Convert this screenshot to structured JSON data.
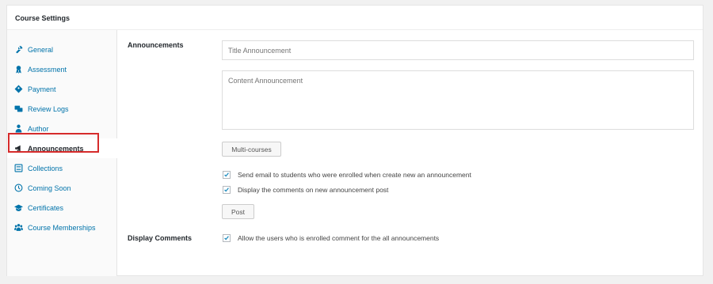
{
  "panel": {
    "title": "Course Settings"
  },
  "sidebar": {
    "items": [
      {
        "label": "General",
        "icon": "wrench-icon",
        "active": false
      },
      {
        "label": "Assessment",
        "icon": "award-icon",
        "active": false
      },
      {
        "label": "Payment",
        "icon": "tag-icon",
        "active": false
      },
      {
        "label": "Review Logs",
        "icon": "logs-icon",
        "active": false
      },
      {
        "label": "Author",
        "icon": "user-icon",
        "active": false
      },
      {
        "label": "Announcements",
        "icon": "megaphone-icon",
        "active": true
      },
      {
        "label": "Collections",
        "icon": "list-icon",
        "active": false
      },
      {
        "label": "Coming Soon",
        "icon": "clock-icon",
        "active": false
      },
      {
        "label": "Certificates",
        "icon": "graduation-cap-icon",
        "active": false
      },
      {
        "label": "Course Memberships",
        "icon": "groups-icon",
        "active": false
      }
    ]
  },
  "announcements": {
    "label": "Announcements",
    "title_placeholder": "Title Announcement",
    "content_placeholder": "Content Announcement",
    "multi_courses_label": "Multi-courses",
    "send_email_label": "Send email to students who were enrolled when create new an announcement",
    "send_email_checked": true,
    "display_comments_post_label": "Display the comments on new announcement post",
    "display_comments_post_checked": true,
    "post_label": "Post"
  },
  "display_comments": {
    "label": "Display Comments",
    "allow_label": "Allow the users who is enrolled comment for the all announcements",
    "allow_checked": true
  },
  "colors": {
    "link": "#0073aa",
    "highlight": "#d62b2b",
    "checkmark": "#1e8cbe"
  }
}
